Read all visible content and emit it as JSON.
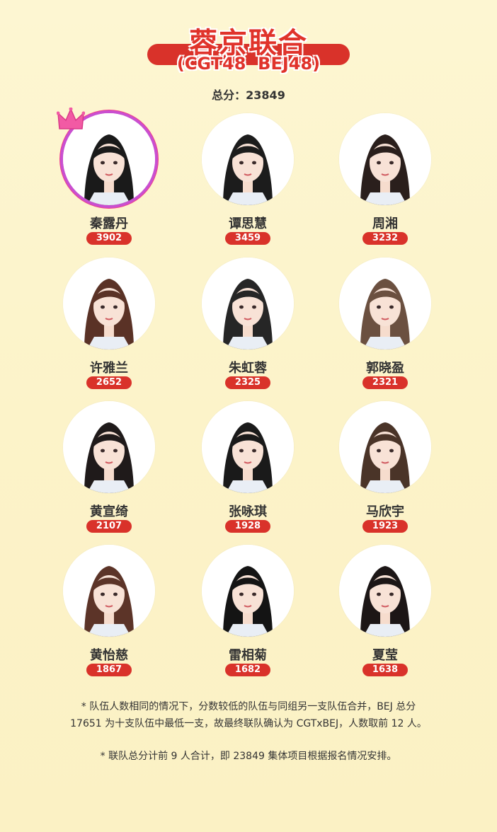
{
  "header": {
    "title": "蓉京联合",
    "subtitle": "(CGT48  BEJ48)",
    "total_label": "总分：23849"
  },
  "colors": {
    "accent": "#d9322a",
    "background": "#fdf6d2",
    "leader_ring": "#c94fd0"
  },
  "members": [
    {
      "name": "秦露丹",
      "score": "3902",
      "leader": true,
      "hair": "#1a1a1a"
    },
    {
      "name": "谭思慧",
      "score": "3459",
      "leader": false,
      "hair": "#1c1c1c"
    },
    {
      "name": "周湘",
      "score": "3232",
      "leader": false,
      "hair": "#2a1f1c"
    },
    {
      "name": "许雅兰",
      "score": "2652",
      "leader": false,
      "hair": "#5a3226"
    },
    {
      "name": "朱虹蓉",
      "score": "2325",
      "leader": false,
      "hair": "#262626"
    },
    {
      "name": "郭晓盈",
      "score": "2321",
      "leader": false,
      "hair": "#6b5040"
    },
    {
      "name": "黄宣绮",
      "score": "2107",
      "leader": false,
      "hair": "#1f1a1a"
    },
    {
      "name": "张咏琪",
      "score": "1928",
      "leader": false,
      "hair": "#1a1a1a"
    },
    {
      "name": "马欣宇",
      "score": "1923",
      "leader": false,
      "hair": "#4a3428"
    },
    {
      "name": "黄怡慈",
      "score": "1867",
      "leader": false,
      "hair": "#5c3428"
    },
    {
      "name": "雷相菊",
      "score": "1682",
      "leader": false,
      "hair": "#141414"
    },
    {
      "name": "夏莹",
      "score": "1638",
      "leader": false,
      "hair": "#1c1616"
    }
  ],
  "notes": {
    "note1_line1": "* 队伍人数相同的情况下，分数较低的队伍与同组另一支队伍合并，BEJ 总分",
    "note1_line2": "17651 为十支队伍中最低一支，故最终联队确认为 CGTxBEJ，人数取前 12 人。",
    "note2": "* 联队总分计前 9 人合计，即 23849 集体项目根据报名情况安排。"
  }
}
